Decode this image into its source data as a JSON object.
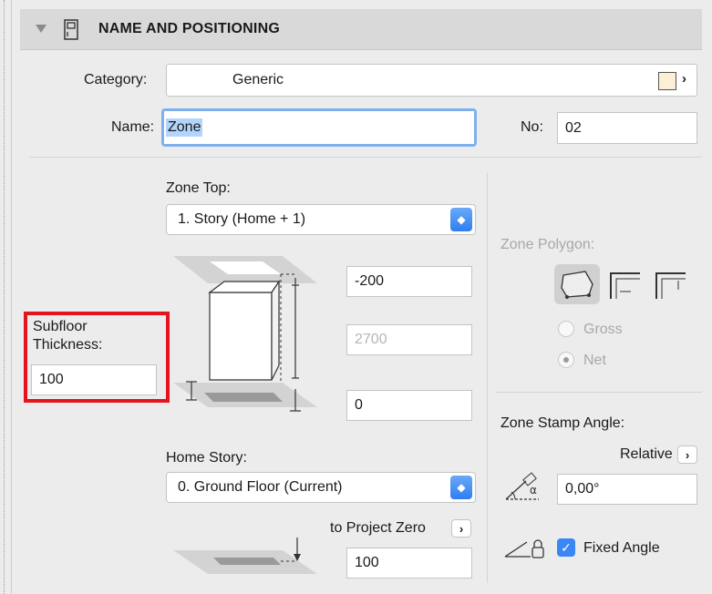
{
  "header": {
    "title": "NAME AND POSITIONING"
  },
  "category": {
    "label": "Category:",
    "value": "Generic",
    "swatch_color": "#fbf0d6"
  },
  "name": {
    "label": "Name:",
    "value": "Zone"
  },
  "number": {
    "label": "No:",
    "value": "02"
  },
  "zone_top": {
    "label": "Zone Top:",
    "selected": "1. Story (Home + 1)",
    "offset_value": "-200",
    "height_value": "2700",
    "bottom_offset_value": "0"
  },
  "subfloor": {
    "label_line1": "Subfloor",
    "label_line2": "Thickness:",
    "value": "100",
    "highlight_color": "#e3141b"
  },
  "home_story": {
    "label": "Home Story:",
    "selected": "0. Ground Floor (Current)",
    "reference_label": "to Project Zero",
    "reference_value": "100"
  },
  "zone_polygon": {
    "label": "Zone Polygon:",
    "options": [
      {
        "label": "Gross",
        "selected": false
      },
      {
        "label": "Net",
        "selected": true
      }
    ]
  },
  "zone_stamp": {
    "label": "Zone Stamp Angle:",
    "mode_label": "Relative",
    "angle_value": "0,00°",
    "fixed_angle_label": "Fixed Angle",
    "fixed_angle_checked": true
  },
  "colors": {
    "accent": "#3b86f5",
    "focus_ring": "#7fb0ee",
    "header_bg": "#d9d9d9"
  }
}
